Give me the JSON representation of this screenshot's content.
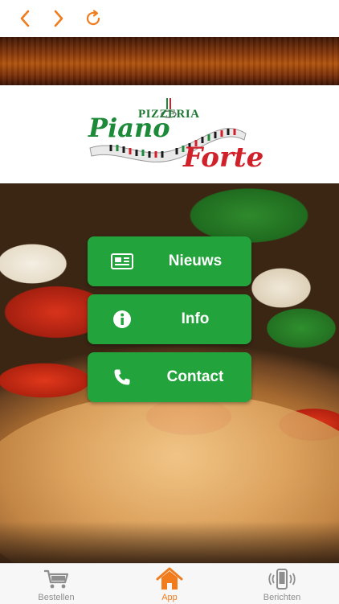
{
  "colors": {
    "accent": "#f07c1e",
    "button_green": "#22a33b",
    "logo_green": "#1d8a3a",
    "logo_red": "#d0202a"
  },
  "nav": {
    "back_icon": "chevron-left-icon",
    "forward_icon": "chevron-right-icon",
    "reload_icon": "reload-icon"
  },
  "logo": {
    "pizzeria": "PIZZERIA",
    "piano": "Piano",
    "forte": "Forte"
  },
  "menu": [
    {
      "label": "Nieuws",
      "icon": "newspaper-icon"
    },
    {
      "label": "Info",
      "icon": "info-icon"
    },
    {
      "label": "Contact",
      "icon": "phone-icon"
    }
  ],
  "tabbar": {
    "items": [
      {
        "label": "Bestellen",
        "icon": "cart-icon",
        "active": false
      },
      {
        "label": "App",
        "icon": "home-icon",
        "active": true
      },
      {
        "label": "Berichten",
        "icon": "phone-vibrate-icon",
        "active": false
      }
    ]
  }
}
